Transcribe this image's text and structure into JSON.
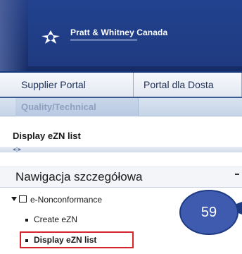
{
  "header": {
    "brand_name": "Pratt & Whitney Canada",
    "icon": "pratt-whitney-logo-icon"
  },
  "tabs": [
    {
      "label": "Supplier Portal"
    },
    {
      "label": "Portal dla Dosta"
    }
  ],
  "subtab": {
    "label": "Quality/Technical"
  },
  "breadcrumb": {
    "text": "Display eZN list"
  },
  "navigation": {
    "title": "Nawigacja szczegółowa",
    "tree": {
      "root_label": "e-Nonconformance",
      "items": [
        {
          "label": "Create eZN"
        },
        {
          "label": "Display eZN list"
        }
      ]
    }
  },
  "callout": {
    "number": "59",
    "fill_color": "#3e5bb0",
    "border_color": "#1e3a82"
  },
  "colors": {
    "header_blue": "#1f3a80",
    "highlight_red": "#d7262b"
  }
}
